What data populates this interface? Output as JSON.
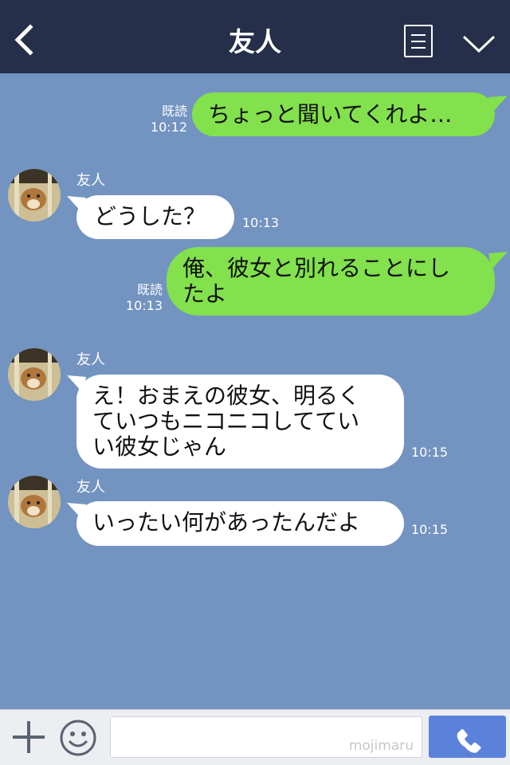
{
  "header": {
    "title": "友人"
  },
  "messages": [
    {
      "side": "mine",
      "text": "ちょっと聞いてくれよ…",
      "read": "既読",
      "time": "10:12"
    },
    {
      "side": "theirs",
      "sender": "友人",
      "text": "どうした？",
      "time": "10:13"
    },
    {
      "side": "mine",
      "lines": [
        "俺、彼女と別れることにし",
        "たよ"
      ],
      "read": "既読",
      "time": "10:13"
    },
    {
      "side": "theirs",
      "sender": "友人",
      "lines": [
        "え！おまえの彼女、明るく",
        "ていつもニコニコしててい",
        "い彼女じゃん"
      ],
      "time": "10:15"
    },
    {
      "side": "theirs",
      "sender": "友人",
      "text": "いったい何があったんだよ",
      "time": "10:15"
    }
  ],
  "footer": {
    "watermark": "mojimaru"
  },
  "colors": {
    "header": "#252f49",
    "background": "#7393c0",
    "my_bubble": "#82e14c",
    "their_bubble": "#ffffff",
    "send_button": "#5b82db"
  }
}
